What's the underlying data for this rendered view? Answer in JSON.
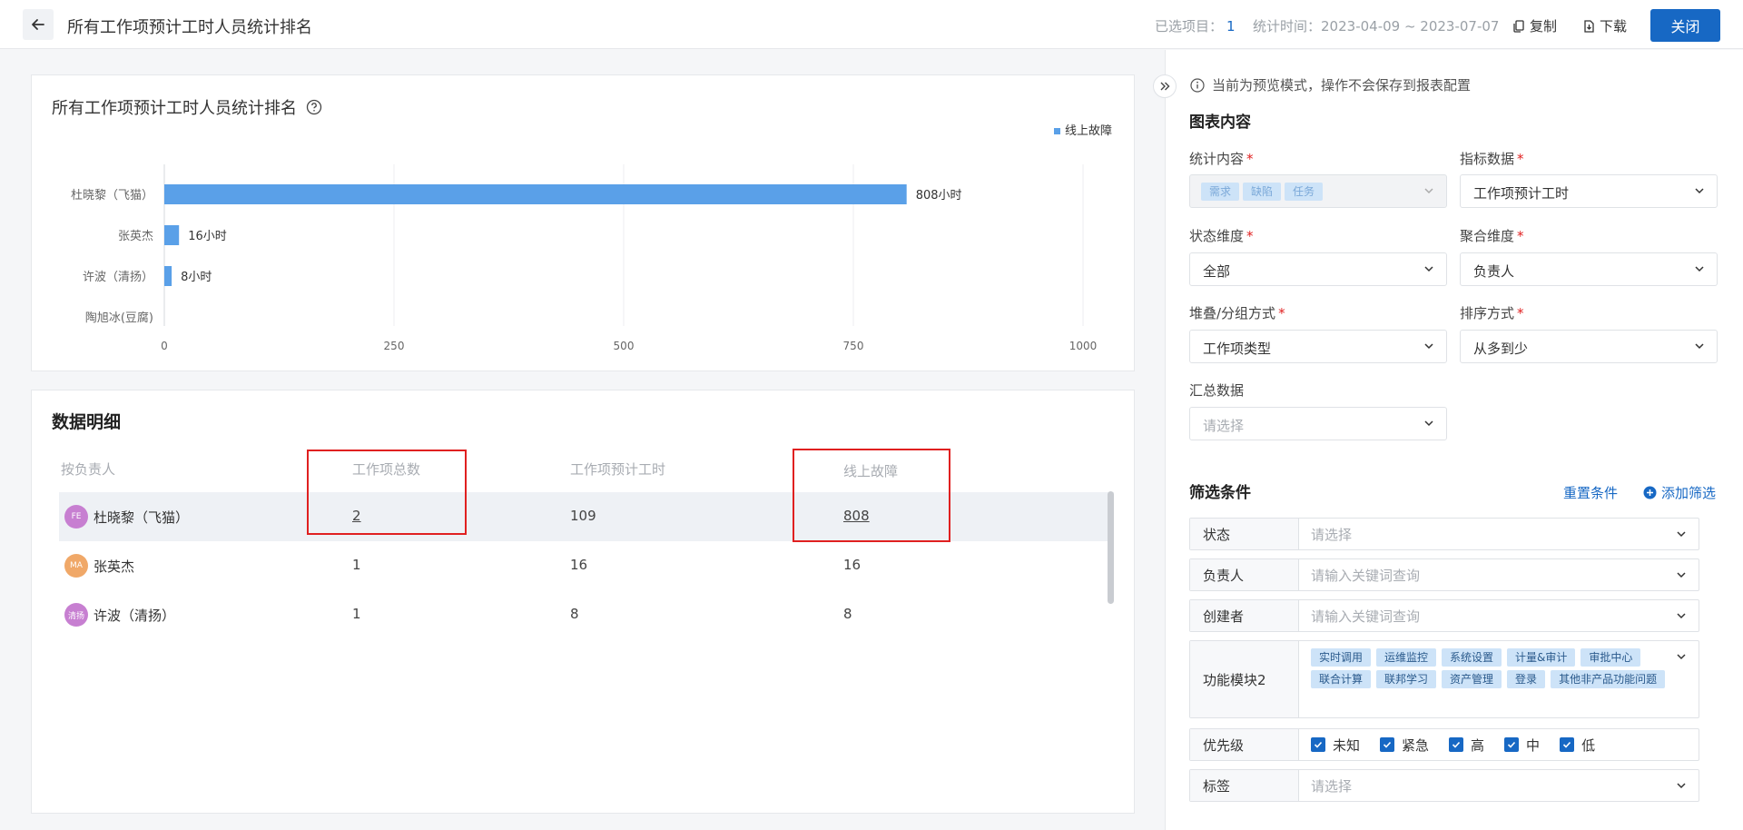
{
  "header": {
    "title": "所有工作项预计工时人员统计排名",
    "selected_label": "已选项目：",
    "selected_value": "1",
    "time_label": "统计时间：",
    "time_value": "2023-04-09 ~ 2023-07-07",
    "copy_label": "复制",
    "download_label": "下载",
    "close_label": "关闭"
  },
  "chart_card": {
    "title": "所有工作项预计工时人员统计排名"
  },
  "chart_data": {
    "type": "bar",
    "orientation": "horizontal",
    "categories": [
      "杜晓黎（飞猫）",
      "张英杰",
      "许波（清扬）",
      "陶旭冰(豆腐)"
    ],
    "series": [
      {
        "name": "线上故障",
        "values": [
          808,
          16,
          8,
          0
        ],
        "color": "#5aa0e8"
      }
    ],
    "value_labels": [
      "808小时",
      "16小时",
      "8小时",
      ""
    ],
    "x_ticks": [
      0,
      250,
      500,
      750,
      1000
    ],
    "xlim": [
      0,
      1000
    ],
    "legend_position": "top-right",
    "grid": true
  },
  "detail": {
    "title": "数据明细",
    "columns": [
      "按负责人",
      "工作项总数",
      "工作项预计工时",
      "线上故障"
    ],
    "rows": [
      {
        "avatar": "FE",
        "avatar_color": "#c77fd1",
        "name": "杜晓黎（飞猫）",
        "total": "2",
        "hours": "109",
        "fault": "808"
      },
      {
        "avatar": "MA",
        "avatar_color": "#f0a868",
        "name": "张英杰",
        "total": "1",
        "hours": "16",
        "fault": "16"
      },
      {
        "avatar": "清扬",
        "avatar_color": "#c77fd1",
        "name": "许波（清扬）",
        "total": "1",
        "hours": "8",
        "fault": "8"
      }
    ]
  },
  "panel": {
    "notice": "当前为预览模式，操作不会保存到报表配置",
    "chart_section": "图表内容",
    "stat_content_label": "统计内容",
    "stat_content_tags": [
      "需求",
      "缺陷",
      "任务"
    ],
    "metric_label": "指标数据",
    "metric_value": "工作项预计工时",
    "status_dim_label": "状态维度",
    "status_dim_value": "全部",
    "agg_dim_label": "聚合维度",
    "agg_dim_value": "负责人",
    "stack_label": "堆叠/分组方式",
    "stack_value": "工作项类型",
    "sort_label": "排序方式",
    "sort_value": "从多到少",
    "summary_label": "汇总数据",
    "summary_placeholder": "请选择",
    "filter_section": "筛选条件",
    "reset_label": "重置条件",
    "add_filter_label": "添加筛选",
    "filters": {
      "status": {
        "label": "状态",
        "placeholder": "请选择"
      },
      "owner": {
        "label": "负责人",
        "placeholder": "请输入关键词查询"
      },
      "creator": {
        "label": "创建者",
        "placeholder": "请输入关键词查询"
      },
      "module": {
        "label": "功能模块2",
        "tags": [
          "实时调用",
          "运维监控",
          "系统设置",
          "计量&审计",
          "审批中心",
          "联合计算",
          "联邦学习",
          "资产管理",
          "登录",
          "其他非产品功能问题"
        ]
      },
      "priority": {
        "label": "优先级",
        "options": [
          "未知",
          "紧急",
          "高",
          "中",
          "低"
        ]
      },
      "tag": {
        "label": "标签",
        "placeholder": "请选择"
      }
    }
  }
}
